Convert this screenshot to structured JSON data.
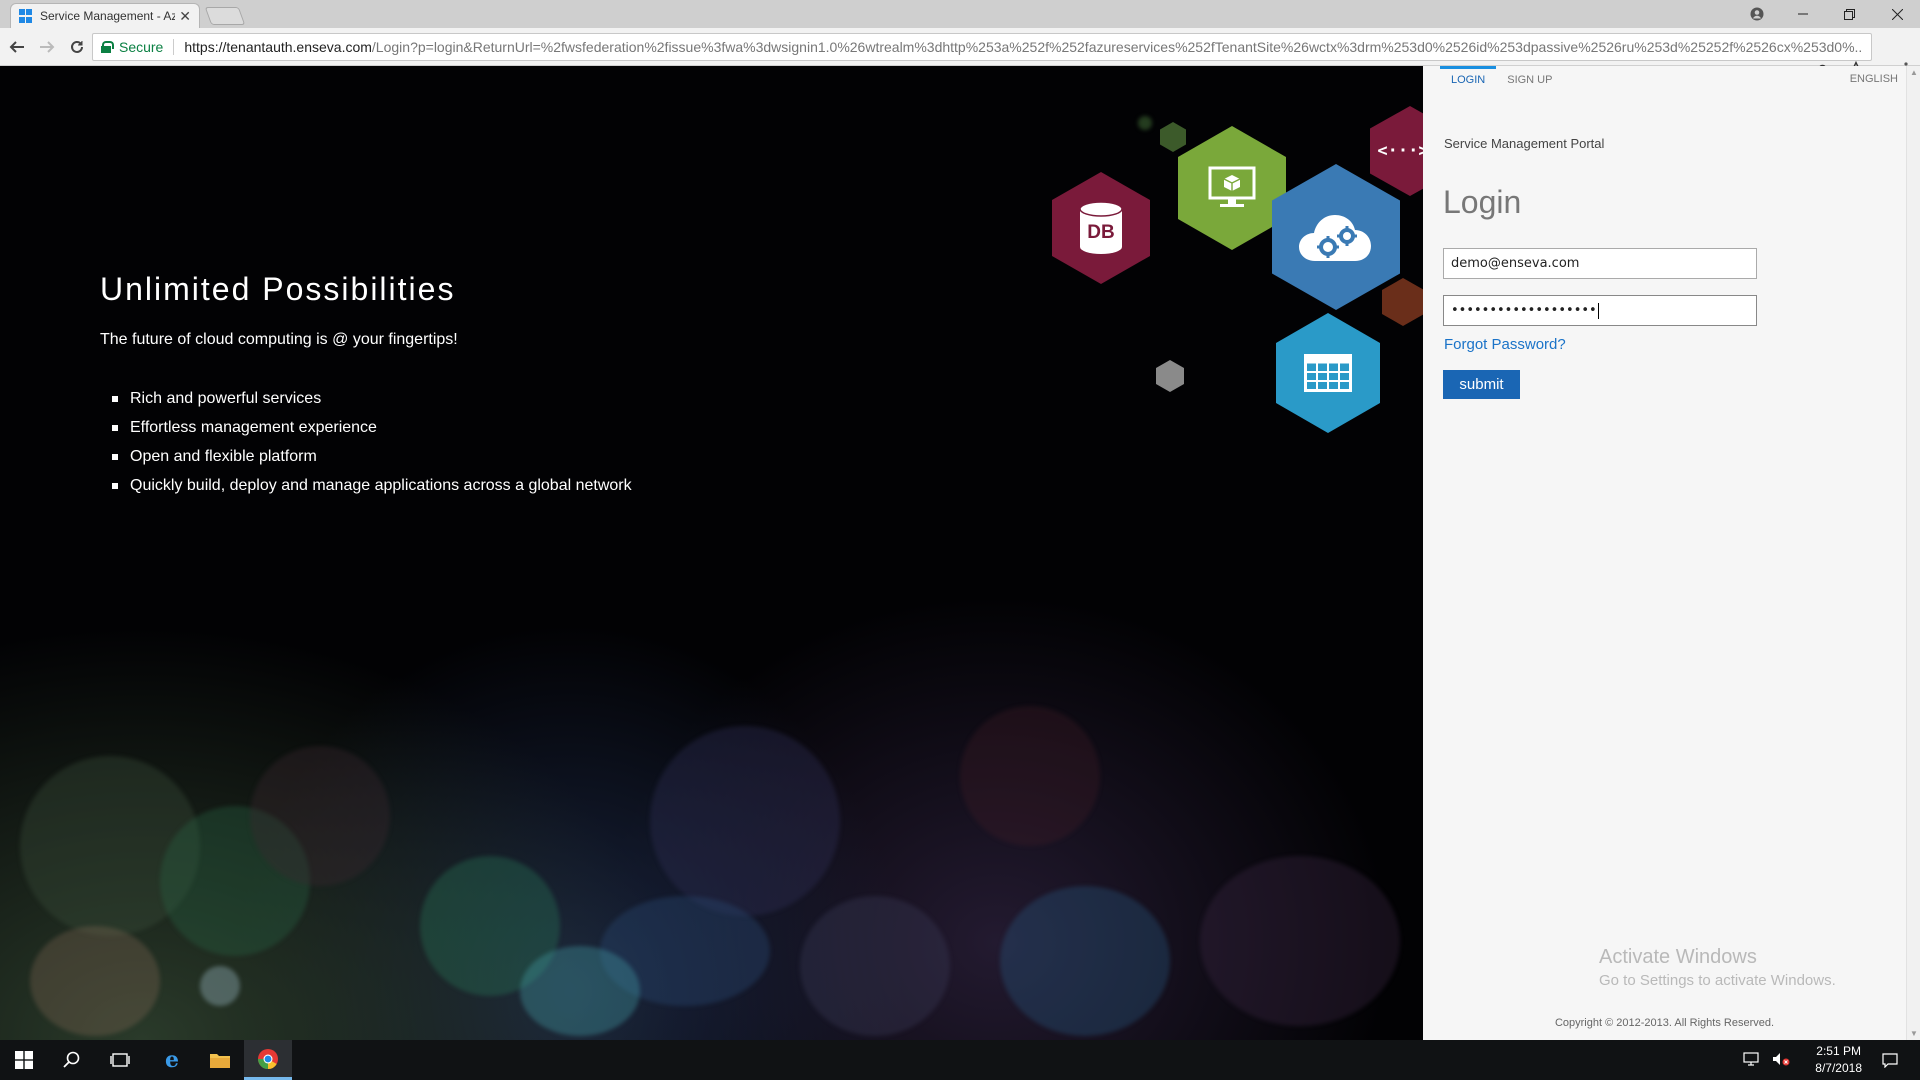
{
  "browser": {
    "tab_title": "Service Management - Azure",
    "tab_close": "✕",
    "secure_label": "Secure",
    "url_host": "https://tenantauth.enseva.com",
    "url_rest": "/Login?p=login&ReturnUrl=%2fwsfederation%2fissue%3fwa%3dwsignin1.0%26wtrealm%3dhttp%253a%252f%252fazureservices%252fTenantSite%26wctx%3drm%253d0%2526id%253dpassive%2526ru%253d%25252f%2526cx%253d0%..."
  },
  "hero": {
    "title": "Unlimited Possibilities",
    "subtitle": "The future of cloud computing is @ your fingertips!",
    "features": [
      "Rich and powerful services",
      "Effortless management experience",
      "Open and flexible platform",
      "Quickly build, deploy and manage applications across a global network"
    ],
    "db_label": "DB",
    "api_label": "<···>"
  },
  "panel": {
    "tab_login": "LOGIN",
    "tab_signup": "SIGN UP",
    "language": "ENGLISH",
    "portal_title": "Service Management Portal",
    "heading": "Login",
    "email_value": "demo@enseva.com",
    "password_value": "•••••••••••••••••••",
    "forgot_link": "Forgot Password?",
    "submit_label": "submit",
    "activate_title": "Activate Windows",
    "activate_sub": "Go to Settings to activate Windows.",
    "copyright": "Copyright © 2012-2013. All Rights Reserved."
  },
  "taskbar": {
    "time": "2:51 PM",
    "date": "8/7/2018"
  },
  "colors": {
    "accent_blue": "#1a66b4",
    "hex_db": "#7a1a3a",
    "hex_vm": "#7aa83a",
    "hex_cloud": "#3a7ab4",
    "hex_table": "#2a9ac8"
  },
  "icons": [
    "windows-logo-icon",
    "search-icon",
    "task-view-icon",
    "edge-icon",
    "file-explorer-icon",
    "chrome-icon",
    "network-icon",
    "volume-icon",
    "notification-icon",
    "lock-icon",
    "key-icon",
    "star-icon"
  ]
}
